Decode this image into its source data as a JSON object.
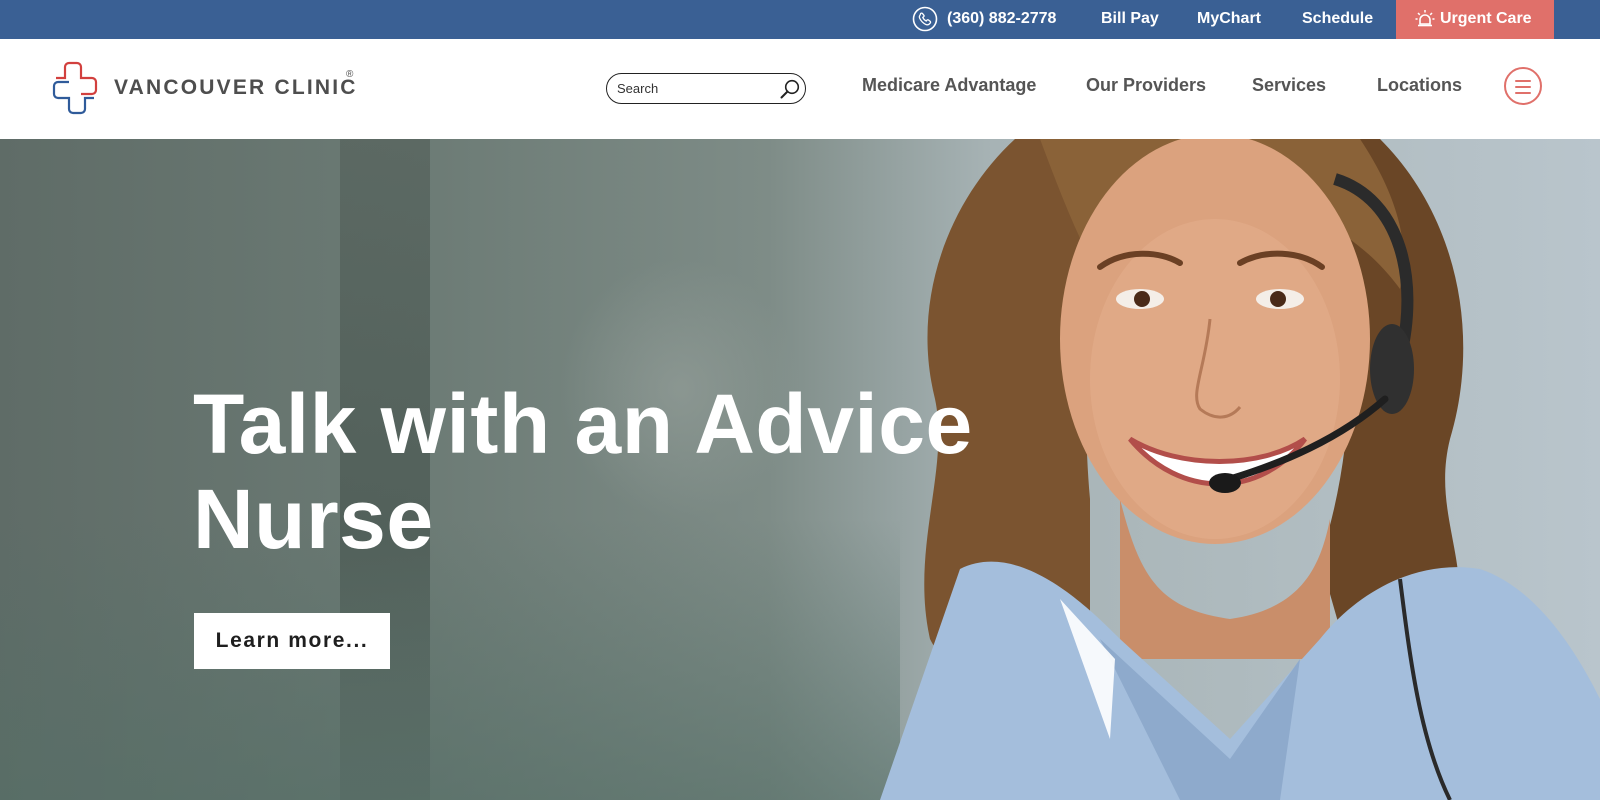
{
  "topbar": {
    "phone": "(360) 882-2778",
    "phone_icon": "phone-icon",
    "bill_pay": "Bill Pay",
    "mychart": "MyChart",
    "schedule": "Schedule",
    "urgent_care": "Urgent Care",
    "urgent_icon": "siren-icon",
    "background_color": "#3a6094",
    "urgent_color": "#e0706a"
  },
  "header": {
    "logo_text": "VANCOUVER CLINIC",
    "logo_reg": "®",
    "search": {
      "placeholder": "Search"
    },
    "nav": [
      {
        "label": "Medicare Advantage"
      },
      {
        "label": "Our Providers"
      },
      {
        "label": "Services"
      },
      {
        "label": "Locations"
      }
    ],
    "menu_icon": "hamburger-menu-icon"
  },
  "hero": {
    "title": "Talk with an Advice Nurse",
    "cta": "Learn more..."
  }
}
